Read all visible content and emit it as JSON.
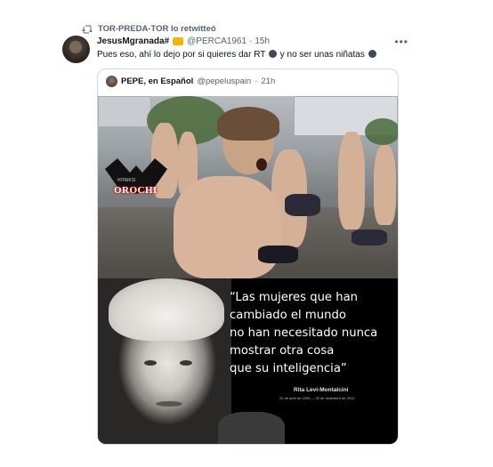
{
  "retweet": {
    "text": "TOR-PREDA-TOR lo retwitteó",
    "icon": "retweet-icon"
  },
  "tweet": {
    "author_name": "JesusMgranada#",
    "author_emoji": "crown-emoji",
    "handle": "@PERCA1961",
    "separator": "·",
    "time": "15h",
    "text_part1": "Pues eso, ahí lo dejo por si quieres dar RT",
    "text_part2": " y no ser unas niñatas",
    "more_icon": "more-icon"
  },
  "quoted_tweet": {
    "author_name": "PEPE, en Español",
    "handle": "@pepeluspain",
    "separator": "·",
    "time": "21h",
    "media": {
      "logo_text": "OROCHI",
      "logo_small_text": "HITAIKSI",
      "quote_lines": [
        "“Las mujeres que han",
        "cambiado el mundo",
        "no han necesitado nunca",
        "mostrar otra cosa",
        "que su inteligencia”"
      ],
      "attribution": "Rita Levi-Montalcini",
      "dates": "22 de abril de 1909 — 30 de diciembre de 2012"
    }
  },
  "colors": {
    "text_primary": "#0f1419",
    "text_secondary": "#536471",
    "border": "#cfd9de"
  }
}
